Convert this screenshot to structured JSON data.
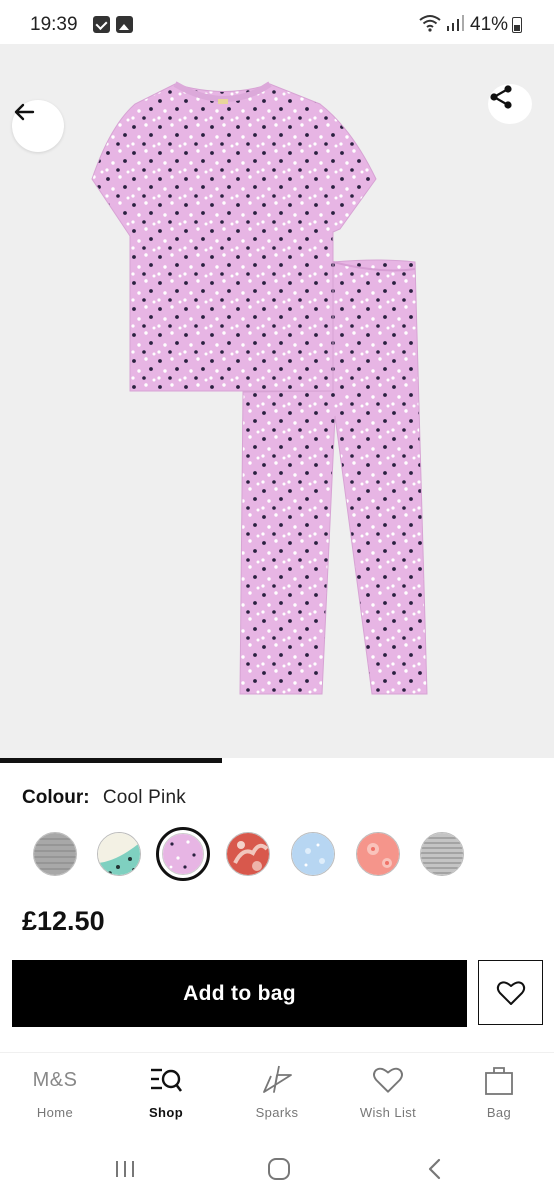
{
  "status_bar": {
    "time": "19:39",
    "battery": "41%"
  },
  "product": {
    "colour_label": "Colour:",
    "colour_value": "Cool Pink",
    "price": "£12.50",
    "image_progress": 0.4,
    "swatches": [
      {
        "name": "grey-stripe",
        "color": "#a8a8a8",
        "selected": false
      },
      {
        "name": "mint-print",
        "color": "#7fd0c0",
        "selected": false
      },
      {
        "name": "cool-pink",
        "color": "#e7b5e4",
        "selected": true
      },
      {
        "name": "red-floral",
        "color": "#d8584c",
        "selected": false
      },
      {
        "name": "blue-print",
        "color": "#b7d6f2",
        "selected": false
      },
      {
        "name": "coral-floral",
        "color": "#f5958b",
        "selected": false
      },
      {
        "name": "grey-stripe-2",
        "color": "#b5b5b5",
        "selected": false
      }
    ]
  },
  "actions": {
    "add_to_bag": "Add to bag"
  },
  "bottom_nav": {
    "logo": "M&S",
    "items": [
      {
        "label": "Home",
        "icon": "ms-logo",
        "active": false
      },
      {
        "label": "Shop",
        "icon": "shop-search-icon",
        "active": true
      },
      {
        "label": "Sparks",
        "icon": "star-icon",
        "active": false
      },
      {
        "label": "Wish List",
        "icon": "heart-icon",
        "active": false
      },
      {
        "label": "Bag",
        "icon": "bag-icon",
        "active": false
      }
    ]
  },
  "colors": {
    "pyjama_pink": "#e7b5e4",
    "hero_background": "#efefef",
    "primary_button": "#000000"
  }
}
